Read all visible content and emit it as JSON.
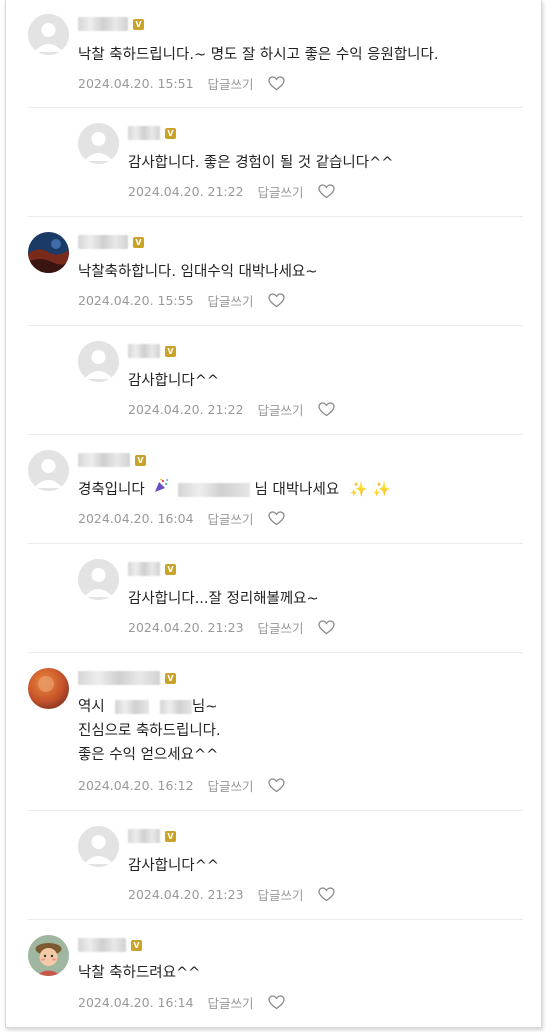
{
  "badge_label": "V",
  "reply_label": "답글쓰기",
  "comments": [
    {
      "text": "낙찰 축하드립니다.~ 명도 잘 하시고 좋은 수익 응원합니다.",
      "date": "2024.04.20. 15:51"
    },
    {
      "text": "감사합니다. 좋은 경험이 될 것 같습니다^^",
      "date": "2024.04.20. 21:22"
    },
    {
      "text": "낙찰축하합니다. 임대수익 대박나세요~",
      "date": "2024.04.20. 15:55"
    },
    {
      "text": "감사합니다^^",
      "date": "2024.04.20. 21:22"
    },
    {
      "text_a": "경축입니다",
      "text_b": "님 대박나세요",
      "date": "2024.04.20. 16:04"
    },
    {
      "text": "감사합니다...잘 정리해볼께요~",
      "date": "2024.04.20. 21:23"
    },
    {
      "line1_a": "역시",
      "line1_b": "님~",
      "line2": "진심으로 축하드립니다.",
      "line3": "좋은 수익 얻으세요^^",
      "date": "2024.04.20. 16:12"
    },
    {
      "text": "감사합니다^^",
      "date": "2024.04.20. 21:23"
    },
    {
      "text": "낙찰 축하드려요^^",
      "date": "2024.04.20. 16:14"
    }
  ]
}
